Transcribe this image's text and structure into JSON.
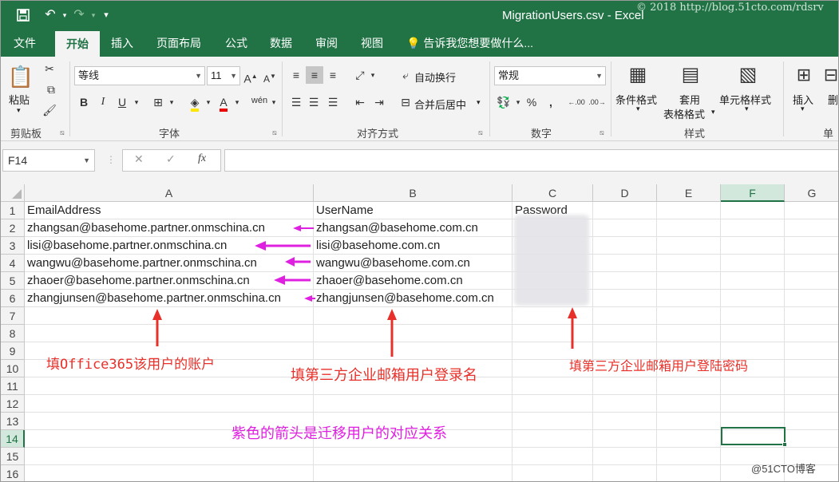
{
  "window": {
    "title": "MigrationUsers.csv - Excel",
    "watermark": "© 2018 http://blog.51cto.com/rdsrv"
  },
  "qat": {
    "save_icon": "save-icon",
    "undo_icon": "undo-icon",
    "redo_icon": "redo-icon",
    "customize_icon": "customize-qat-icon"
  },
  "tabs": [
    {
      "label": "文件"
    },
    {
      "label": "开始"
    },
    {
      "label": "插入"
    },
    {
      "label": "页面布局"
    },
    {
      "label": "公式"
    },
    {
      "label": "数据"
    },
    {
      "label": "审阅"
    },
    {
      "label": "视图"
    }
  ],
  "tell_me": "告诉我您想要做什么...",
  "ribbon": {
    "clipboard": {
      "label": "剪贴板",
      "paste": "粘贴"
    },
    "font": {
      "label": "字体",
      "name": "等线",
      "size": "11"
    },
    "alignment": {
      "label": "对齐方式",
      "wrap": "自动换行",
      "merge": "合并后居中"
    },
    "number": {
      "label": "数字",
      "format": "常规"
    },
    "styles": {
      "label": "样式",
      "cond": "条件格式",
      "table_1": "套用",
      "table_2": "表格格式",
      "cell": "单元格样式"
    },
    "cells": {
      "insert": "插入",
      "delete": "删",
      "label": "单"
    }
  },
  "formula_bar": {
    "name_box": "F14",
    "value": ""
  },
  "columns": [
    "A",
    "B",
    "C",
    "D",
    "E",
    "F",
    "G"
  ],
  "rows": [
    "1",
    "2",
    "3",
    "4",
    "5",
    "6",
    "7",
    "8",
    "9",
    "10",
    "11",
    "12",
    "13",
    "14",
    "15",
    "16"
  ],
  "selected_cell": {
    "col": "F",
    "row": "14"
  },
  "table": {
    "headers": [
      "EmailAddress",
      "UserName",
      "Password"
    ],
    "rows": [
      [
        "zhangsan@basehome.partner.onmschina.cn",
        "zhangsan@basehome.com.cn"
      ],
      [
        "lisi@basehome.partner.onmschina.cn",
        "lisi@basehome.com.cn"
      ],
      [
        "wangwu@basehome.partner.onmschina.cn",
        "wangwu@basehome.com.cn"
      ],
      [
        "zhaoer@basehome.partner.onmschina.cn",
        "zhaoer@basehome.com.cn"
      ],
      [
        "zhangjunsen@basehome.partner.onmschina.cn",
        "zhangjunsen@basehome.com.cn"
      ]
    ]
  },
  "annotations": {
    "note_a": "填Office365该用户的账户",
    "note_b": "填第三方企业邮箱用户登录名",
    "note_c": "填第三方企业邮箱用户登陆密码",
    "note_arrows": "紫色的箭头是迁移用户的对应关系",
    "red_color": "#e8302a",
    "purple_color": "#e020e0"
  },
  "corner_watermark": "@51CTO博客",
  "colors": {
    "brand": "#217346",
    "ribbon_bg": "#f3f3f3"
  }
}
